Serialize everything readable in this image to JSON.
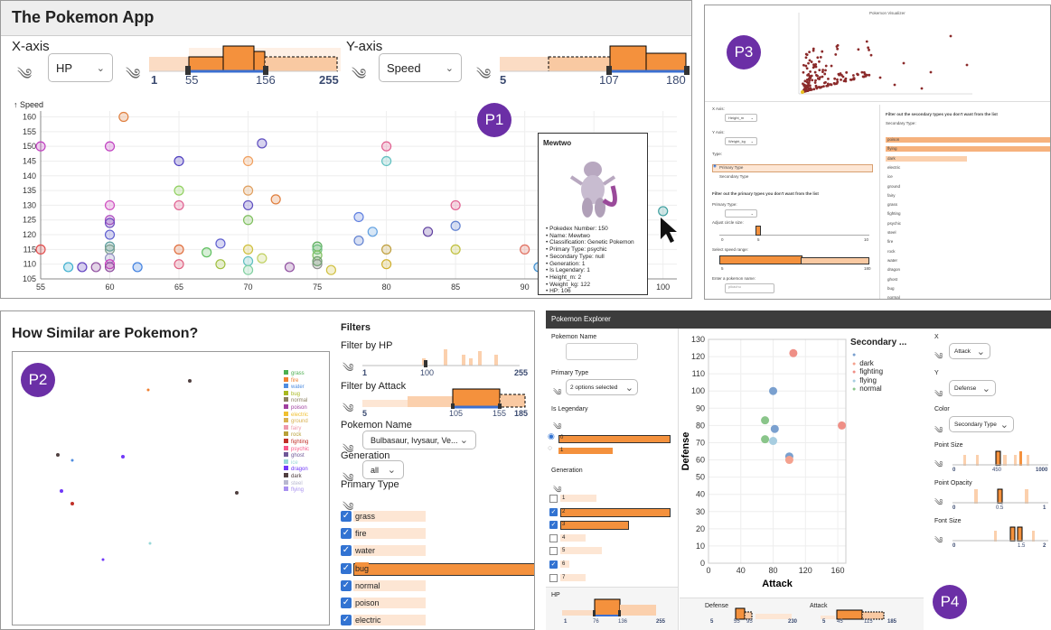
{
  "p1": {
    "title": "The Pokemon App",
    "x_axis_label": "X-axis",
    "y_axis_label": "Y-axis",
    "x_select": "HP",
    "y_select": "Speed",
    "hp_range": {
      "min": "1",
      "lo": "55",
      "hi": "156",
      "max": "255"
    },
    "speed_range": {
      "min": "5",
      "lo": "107",
      "hi": "180"
    },
    "badge": "P1",
    "chart_data": {
      "type": "scatter",
      "ylabel": "↑ Speed",
      "xlim": [
        55,
        101
      ],
      "ylim": [
        105,
        162
      ],
      "x_ticks": [
        55,
        60,
        65,
        70,
        75,
        80,
        85,
        90,
        95,
        100
      ],
      "y_ticks": [
        105,
        110,
        115,
        120,
        125,
        130,
        135,
        140,
        145,
        150,
        155,
        160
      ],
      "points": [
        {
          "x": 55,
          "y": 150,
          "c": "#c040c0"
        },
        {
          "x": 55,
          "y": 115,
          "c": "#e05050"
        },
        {
          "x": 57,
          "y": 109,
          "c": "#40b0d0"
        },
        {
          "x": 58,
          "y": 109,
          "c": "#6040c0"
        },
        {
          "x": 59,
          "y": 109,
          "c": "#9050a0"
        },
        {
          "x": 60,
          "y": 150,
          "c": "#c040c0"
        },
        {
          "x": 60,
          "y": 130,
          "c": "#d050c0"
        },
        {
          "x": 60,
          "y": 125,
          "c": "#b050c0"
        },
        {
          "x": 60,
          "y": 124,
          "c": "#7050c0"
        },
        {
          "x": 60,
          "y": 120,
          "c": "#6060d0"
        },
        {
          "x": 60,
          "y": 116,
          "c": "#60a0a0"
        },
        {
          "x": 60,
          "y": 115,
          "c": "#80a090"
        },
        {
          "x": 60,
          "y": 112,
          "c": "#9090c0"
        },
        {
          "x": 60,
          "y": 110,
          "c": "#d040c0"
        },
        {
          "x": 60,
          "y": 109,
          "c": "#9050a0"
        },
        {
          "x": 62,
          "y": 109,
          "c": "#4080e0"
        },
        {
          "x": 61,
          "y": 160,
          "c": "#e08040"
        },
        {
          "x": 65,
          "y": 145,
          "c": "#5040c0"
        },
        {
          "x": 65,
          "y": 135,
          "c": "#90d060"
        },
        {
          "x": 65,
          "y": 130,
          "c": "#e06090"
        },
        {
          "x": 65,
          "y": 115,
          "c": "#e07040"
        },
        {
          "x": 65,
          "y": 110,
          "c": "#e06080"
        },
        {
          "x": 67,
          "y": 114,
          "c": "#60c060"
        },
        {
          "x": 68,
          "y": 117,
          "c": "#6060d0"
        },
        {
          "x": 68,
          "y": 110,
          "c": "#a0c040"
        },
        {
          "x": 70,
          "y": 145,
          "c": "#f0a060"
        },
        {
          "x": 70,
          "y": 135,
          "c": "#e0a060"
        },
        {
          "x": 70,
          "y": 130,
          "c": "#6050c0"
        },
        {
          "x": 70,
          "y": 125,
          "c": "#80c060"
        },
        {
          "x": 70,
          "y": 115,
          "c": "#d0c040"
        },
        {
          "x": 70,
          "y": 111,
          "c": "#60c0c0"
        },
        {
          "x": 70,
          "y": 108,
          "c": "#80d0a0"
        },
        {
          "x": 71,
          "y": 151,
          "c": "#6050c0"
        },
        {
          "x": 71,
          "y": 112,
          "c": "#c0d060"
        },
        {
          "x": 72,
          "y": 132,
          "c": "#e08040"
        },
        {
          "x": 73,
          "y": 109,
          "c": "#9050a0"
        },
        {
          "x": 75,
          "y": 116,
          "c": "#60b060"
        },
        {
          "x": 75,
          "y": 115,
          "c": "#70c080"
        },
        {
          "x": 75,
          "y": 113,
          "c": "#80c060"
        },
        {
          "x": 75,
          "y": 110,
          "c": "#909090"
        },
        {
          "x": 75,
          "y": 111,
          "c": "#70a070"
        },
        {
          "x": 76,
          "y": 108,
          "c": "#d0c040"
        },
        {
          "x": 78,
          "y": 126,
          "c": "#6080e0"
        },
        {
          "x": 78,
          "y": 118,
          "c": "#6080d0"
        },
        {
          "x": 79,
          "y": 121,
          "c": "#60a0e0"
        },
        {
          "x": 80,
          "y": 150,
          "c": "#e06090"
        },
        {
          "x": 80,
          "y": 145,
          "c": "#60c0c0"
        },
        {
          "x": 80,
          "y": 115,
          "c": "#c0a040"
        },
        {
          "x": 80,
          "y": 110,
          "c": "#d0b030"
        },
        {
          "x": 83,
          "y": 121,
          "c": "#6040a0"
        },
        {
          "x": 85,
          "y": 130,
          "c": "#e06090"
        },
        {
          "x": 85,
          "y": 123,
          "c": "#6080d0"
        },
        {
          "x": 85,
          "y": 115,
          "c": "#c0c040"
        },
        {
          "x": 90,
          "y": 115,
          "c": "#e07060"
        },
        {
          "x": 91,
          "y": 109,
          "c": "#4090d0"
        },
        {
          "x": 100,
          "y": 128,
          "c": "#40a0a0"
        }
      ]
    },
    "tooltip": {
      "name": "Mewtwo",
      "lines": [
        "Pokedex Number: 150",
        "Name: Mewtwo",
        "Classification: Genetic Pokemon",
        "Primary Type: psychic",
        "Secondary Type: null",
        "Generation: 1",
        "Is Legendary: 1",
        "Height_m: 2",
        "Weight_kg: 122",
        "HP: 106"
      ]
    }
  },
  "p2": {
    "title": "How Similar are Pokemon?",
    "badge": "P2",
    "filters_heading": "Filters",
    "filter_hp": "Filter by HP",
    "hp_ticks": {
      "min": "1",
      "mid": "100",
      "max": "255"
    },
    "filter_attack": "Filter by Attack",
    "atk_ticks": {
      "min": "5",
      "lo": "105",
      "hi": "155",
      "max": "185"
    },
    "name_label": "Pokemon Name",
    "name_value": "Bulbasaur, Ivysaur, Ve...",
    "gen_label": "Generation",
    "gen_value": "all",
    "ptype_label": "Primary Type",
    "types": [
      "grass",
      "fire",
      "water",
      "bug",
      "normal",
      "poison",
      "electric"
    ],
    "legend": [
      {
        "name": "grass",
        "c": "#4caf50"
      },
      {
        "name": "fire",
        "c": "#f08030"
      },
      {
        "name": "water",
        "c": "#4f8de0"
      },
      {
        "name": "bug",
        "c": "#a8b820"
      },
      {
        "name": "normal",
        "c": "#8a7f60"
      },
      {
        "name": "poison",
        "c": "#a040a0"
      },
      {
        "name": "electric",
        "c": "#f0c030"
      },
      {
        "name": "ground",
        "c": "#d8b050"
      },
      {
        "name": "fairy",
        "c": "#ee99ac"
      },
      {
        "name": "rock",
        "c": "#b8a038"
      },
      {
        "name": "fighting",
        "c": "#c03028"
      },
      {
        "name": "psychic",
        "c": "#f85888"
      },
      {
        "name": "ghost",
        "c": "#705898"
      },
      {
        "name": "ice",
        "c": "#98d8d8"
      },
      {
        "name": "dragon",
        "c": "#7038f8"
      },
      {
        "name": "dark",
        "c": "#504040"
      },
      {
        "name": "steel",
        "c": "#b8b8d0"
      },
      {
        "name": "flying",
        "c": "#a890f0"
      }
    ]
  },
  "p3": {
    "badge": "P3",
    "plot_title": "Pokemon Visualizer",
    "x_axis": "X Axis:",
    "x_value": "Height_m",
    "y_axis": "Y Axis:",
    "y_value": "Weight_kg",
    "type_label": "Type:",
    "primary_type": "Primary Type",
    "secondary_type": "Secondary Type",
    "filter_primary": "Filter out the primary types you don't want from the list",
    "primary_type_label": "Primary Type:",
    "circle_size": "Adjust circle size:",
    "circle_ticks": [
      "0",
      "5",
      "10"
    ],
    "speed_range": "Select speed range:",
    "speed_ticks": [
      "5",
      "180"
    ],
    "enter_name": "Enter a pokemon name:",
    "name_placeholder": "pikachu",
    "filter_secondary": "Filter out the secondary types you don't want from the list",
    "secondary_label": "Secondary Type:",
    "sec_types": [
      "poison",
      "flying",
      "dark",
      "electric",
      "ice",
      "ground",
      "fairy",
      "grass",
      "fighting",
      "psychic",
      "steel",
      "fire",
      "rock",
      "water",
      "dragon",
      "ghost",
      "bug",
      "normal"
    ]
  },
  "p4": {
    "badge": "P4",
    "header": "Pokemon Explorer",
    "name_label": "Pokemon Name",
    "ptype_label": "Primary Type",
    "ptype_value": "2 options selected",
    "legendary_label": "Is Legendary",
    "legendary_opts": [
      "0",
      "1"
    ],
    "gen_label": "Generation",
    "gens": [
      "1",
      "2",
      "3",
      "4",
      "5",
      "6",
      "7"
    ],
    "hp_label": "HP",
    "hp_ticks": [
      "1",
      "76",
      "136",
      "255"
    ],
    "def_label": "Defense",
    "def_ticks": [
      "5",
      "55",
      "95",
      "230"
    ],
    "atk_label": "Attack",
    "atk_ticks": [
      "5",
      "45",
      "115",
      "185"
    ],
    "x_label": "X",
    "x_value": "Attack",
    "y_label": "Y",
    "y_value": "Defense",
    "color_label": "Color",
    "color_value": "Secondary Type",
    "point_size": "Point Size",
    "ps_ticks": [
      "0",
      "450",
      "1000"
    ],
    "point_opacity": "Point Opacity",
    "po_ticks": [
      "0",
      "0.5",
      "1"
    ],
    "font_size": "Font Size",
    "fs_ticks": [
      "0",
      "1.5",
      "2"
    ],
    "chart_data": {
      "type": "scatter",
      "xlabel": "Attack",
      "ylabel": "Defense",
      "xlim": [
        0,
        170
      ],
      "ylim": [
        0,
        130
      ],
      "x_ticks": [
        0,
        40,
        80,
        120,
        160
      ],
      "y_ticks": [
        0,
        10,
        20,
        30,
        40,
        50,
        60,
        70,
        80,
        90,
        100,
        110,
        120,
        130
      ],
      "legend_title": "Secondary ...",
      "legend": [
        {
          "name": "",
          "c": "#7aa0cf"
        },
        {
          "name": "dark",
          "c": "#f4a18e"
        },
        {
          "name": "fighting",
          "c": "#ef8f86"
        },
        {
          "name": "flying",
          "c": "#a7cde0"
        },
        {
          "name": "normal",
          "c": "#8ac58a"
        }
      ],
      "points": [
        {
          "x": 105,
          "y": 122,
          "c": "#ef8f86"
        },
        {
          "x": 80,
          "y": 100,
          "c": "#7aa0cf"
        },
        {
          "x": 70,
          "y": 83,
          "c": "#8ac58a"
        },
        {
          "x": 82,
          "y": 78,
          "c": "#7aa0cf"
        },
        {
          "x": 165,
          "y": 80,
          "c": "#ef8f86"
        },
        {
          "x": 70,
          "y": 72,
          "c": "#8ac58a"
        },
        {
          "x": 80,
          "y": 71,
          "c": "#a7cde0"
        },
        {
          "x": 100,
          "y": 62,
          "c": "#7aa0cf"
        },
        {
          "x": 100,
          "y": 60,
          "c": "#f4a18e"
        }
      ]
    }
  }
}
